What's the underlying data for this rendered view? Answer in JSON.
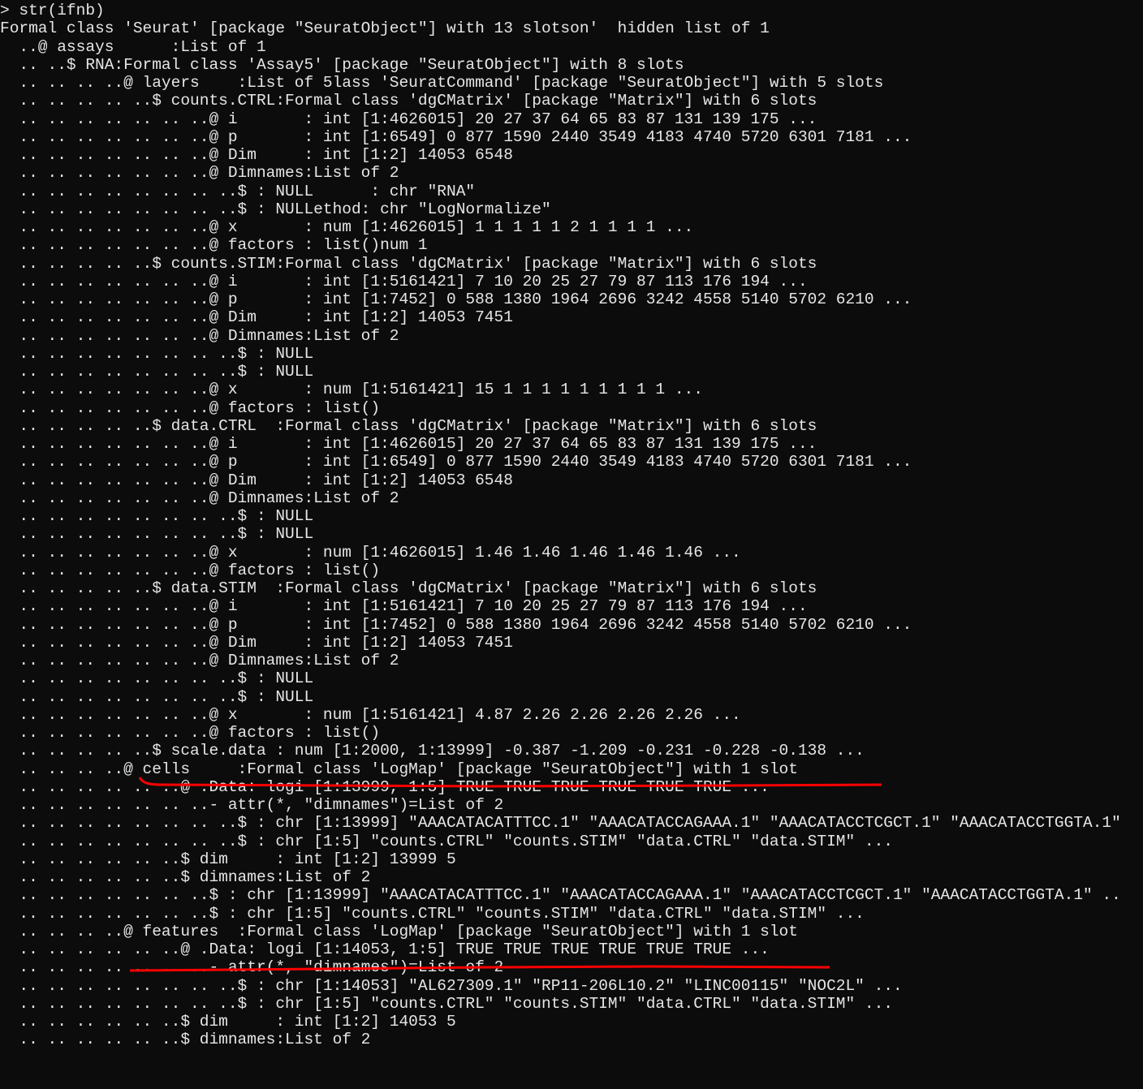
{
  "terminal": {
    "background": "#0c0c0c",
    "foreground": "#e6e6e6",
    "annotation_color": "#ff0000",
    "lines": [
      "> str(ifnb)",
      "Formal class 'Seurat' [package \"SeuratObject\"] with 13 slotson'  hidden list of 1",
      "  ..@ assays      :List of 1",
      "  .. ..$ RNA:Formal class 'Assay5' [package \"SeuratObject\"] with 8 slots",
      "  .. .. .. ..@ layers    :List of 5lass 'SeuratCommand' [package \"SeuratObject\"] with 5 slots",
      "  .. .. .. .. ..$ counts.CTRL:Formal class 'dgCMatrix' [package \"Matrix\"] with 6 slots",
      "  .. .. .. .. .. .. ..@ i       : int [1:4626015] 20 27 37 64 65 83 87 131 139 175 ...",
      "  .. .. .. .. .. .. ..@ p       : int [1:6549] 0 877 1590 2440 3549 4183 4740 5720 6301 7181 ...",
      "  .. .. .. .. .. .. ..@ Dim     : int [1:2] 14053 6548",
      "  .. .. .. .. .. .. ..@ Dimnames:List of 2",
      "  .. .. .. .. .. .. .. ..$ : NULL      : chr \"RNA\"",
      "  .. .. .. .. .. .. .. ..$ : NULLethod: chr \"LogNormalize\"",
      "  .. .. .. .. .. .. ..@ x       : num [1:4626015] 1 1 1 1 1 2 1 1 1 1 ...",
      "  .. .. .. .. .. .. ..@ factors : list()num 1",
      "  .. .. .. .. ..$ counts.STIM:Formal class 'dgCMatrix' [package \"Matrix\"] with 6 slots",
      "  .. .. .. .. .. .. ..@ i       : int [1:5161421] 7 10 20 25 27 79 87 113 176 194 ...",
      "  .. .. .. .. .. .. ..@ p       : int [1:7452] 0 588 1380 1964 2696 3242 4558 5140 5702 6210 ...",
      "  .. .. .. .. .. .. ..@ Dim     : int [1:2] 14053 7451",
      "  .. .. .. .. .. .. ..@ Dimnames:List of 2",
      "  .. .. .. .. .. .. .. ..$ : NULL",
      "  .. .. .. .. .. .. .. ..$ : NULL",
      "  .. .. .. .. .. .. ..@ x       : num [1:5161421] 15 1 1 1 1 1 1 1 1 1 ...",
      "  .. .. .. .. .. .. ..@ factors : list()",
      "  .. .. .. .. ..$ data.CTRL  :Formal class 'dgCMatrix' [package \"Matrix\"] with 6 slots",
      "  .. .. .. .. .. .. ..@ i       : int [1:4626015] 20 27 37 64 65 83 87 131 139 175 ...",
      "  .. .. .. .. .. .. ..@ p       : int [1:6549] 0 877 1590 2440 3549 4183 4740 5720 6301 7181 ...",
      "  .. .. .. .. .. .. ..@ Dim     : int [1:2] 14053 6548",
      "  .. .. .. .. .. .. ..@ Dimnames:List of 2",
      "  .. .. .. .. .. .. .. ..$ : NULL",
      "  .. .. .. .. .. .. .. ..$ : NULL",
      "  .. .. .. .. .. .. ..@ x       : num [1:4626015] 1.46 1.46 1.46 1.46 1.46 ...",
      "  .. .. .. .. .. .. ..@ factors : list()",
      "  .. .. .. .. ..$ data.STIM  :Formal class 'dgCMatrix' [package \"Matrix\"] with 6 slots",
      "  .. .. .. .. .. .. ..@ i       : int [1:5161421] 7 10 20 25 27 79 87 113 176 194 ...",
      "  .. .. .. .. .. .. ..@ p       : int [1:7452] 0 588 1380 1964 2696 3242 4558 5140 5702 6210 ...",
      "  .. .. .. .. .. .. ..@ Dim     : int [1:2] 14053 7451",
      "  .. .. .. .. .. .. ..@ Dimnames:List of 2",
      "  .. .. .. .. .. .. .. ..$ : NULL",
      "  .. .. .. .. .. .. .. ..$ : NULL",
      "  .. .. .. .. .. .. ..@ x       : num [1:5161421] 4.87 2.26 2.26 2.26 2.26 ...",
      "  .. .. .. .. .. .. ..@ factors : list()",
      "  .. .. .. .. ..$ scale.data : num [1:2000, 1:13999] -0.387 -1.209 -0.231 -0.228 -0.138 ...",
      "  .. .. .. ..@ cells     :Formal class 'LogMap' [package \"SeuratObject\"] with 1 slot",
      "  .. .. .. .. .. ..@ .Data: logi [1:13999, 1:5] TRUE TRUE TRUE TRUE TRUE TRUE ...",
      "  .. .. .. .. .. .. ..- attr(*, \"dimnames\")=List of 2",
      "  .. .. .. .. .. .. .. ..$ : chr [1:13999] \"AAACATACATTTCC.1\" \"AAACATACCAGAAA.1\" \"AAACATACCTCGCT.1\" \"AAACATACCTGGTA.1\"",
      "  .. .. .. .. .. .. .. ..$ : chr [1:5] \"counts.CTRL\" \"counts.STIM\" \"data.CTRL\" \"data.STIM\" ...",
      "  .. .. .. .. .. ..$ dim     : int [1:2] 13999 5",
      "  .. .. .. .. .. ..$ dimnames:List of 2",
      "  .. .. .. .. .. .. ..$ : chr [1:13999] \"AAACATACATTTCC.1\" \"AAACATACCAGAAA.1\" \"AAACATACCTCGCT.1\" \"AAACATACCTGGTA.1\" ..",
      "  .. .. .. .. .. .. ..$ : chr [1:5] \"counts.CTRL\" \"counts.STIM\" \"data.CTRL\" \"data.STIM\" ...",
      "  .. .. .. ..@ features  :Formal class 'LogMap' [package \"SeuratObject\"] with 1 slot",
      "  .. .. .. .. .. ..@ .Data: logi [1:14053, 1:5] TRUE TRUE TRUE TRUE TRUE TRUE ...",
      "  .. .. .. .. .. .. ..- attr(*, \"dimnames\")=List of 2",
      "  .. .. .. .. .. .. .. ..$ : chr [1:14053] \"AL627309.1\" \"RP11-206L10.2\" \"LINC00115\" \"NOC2L\" ...",
      "  .. .. .. .. .. .. .. ..$ : chr [1:5] \"counts.CTRL\" \"counts.STIM\" \"data.CTRL\" \"data.STIM\" ...",
      "  .. .. .. .. .. ..$ dim     : int [1:2] 14053 5",
      "  .. .. .. .. .. ..$ dimnames:List of 2"
    ]
  }
}
